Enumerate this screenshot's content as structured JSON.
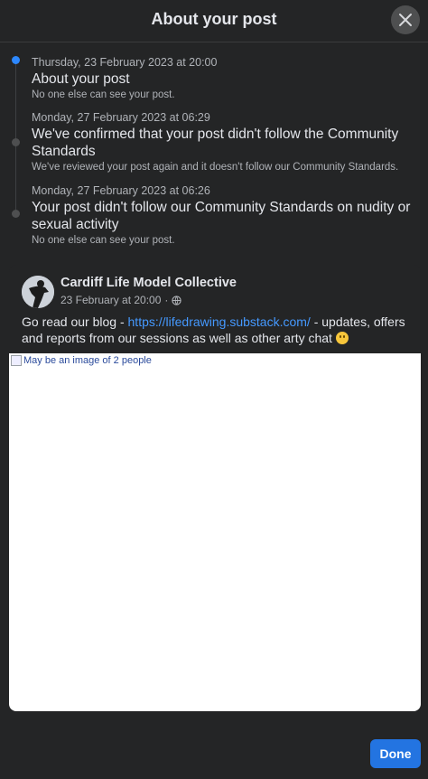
{
  "dialog": {
    "title": "About your post",
    "close_icon": "close-icon"
  },
  "timeline": [
    {
      "date": "Thursday, 23 February 2023 at 20:00",
      "title": "About your post",
      "description": "No one else can see your post.",
      "active": true
    },
    {
      "date": "Monday, 27 February 2023 at 06:29",
      "title": "We've confirmed that your post didn't follow the Community Standards",
      "description": "We've reviewed your post again and it doesn't follow our Community Standards.",
      "active": false
    },
    {
      "date": "Monday, 27 February 2023 at 06:26",
      "title": "Your post didn't follow our Community Standards on nudity or sexual activity",
      "description": "No one else can see your post.",
      "active": false
    }
  ],
  "post": {
    "author": "Cardiff Life Model Collective",
    "timestamp": "23 February at 20:00",
    "separator": "·",
    "audience_icon": "globe-icon",
    "text_before": "Go read our blog - ",
    "link": "https://lifedrawing.substack.com/",
    "text_after": " - updates, offers and reports from our sessions as well as other arty chat ",
    "emoji_icon": "smiley-emoji",
    "image_alt": "May be an image of 2 people"
  },
  "footer": {
    "done_label": "Done"
  },
  "colors": {
    "background": "#242526",
    "accent": "#2374e1",
    "link": "#4599ff",
    "active_dot": "#2d88ff"
  }
}
